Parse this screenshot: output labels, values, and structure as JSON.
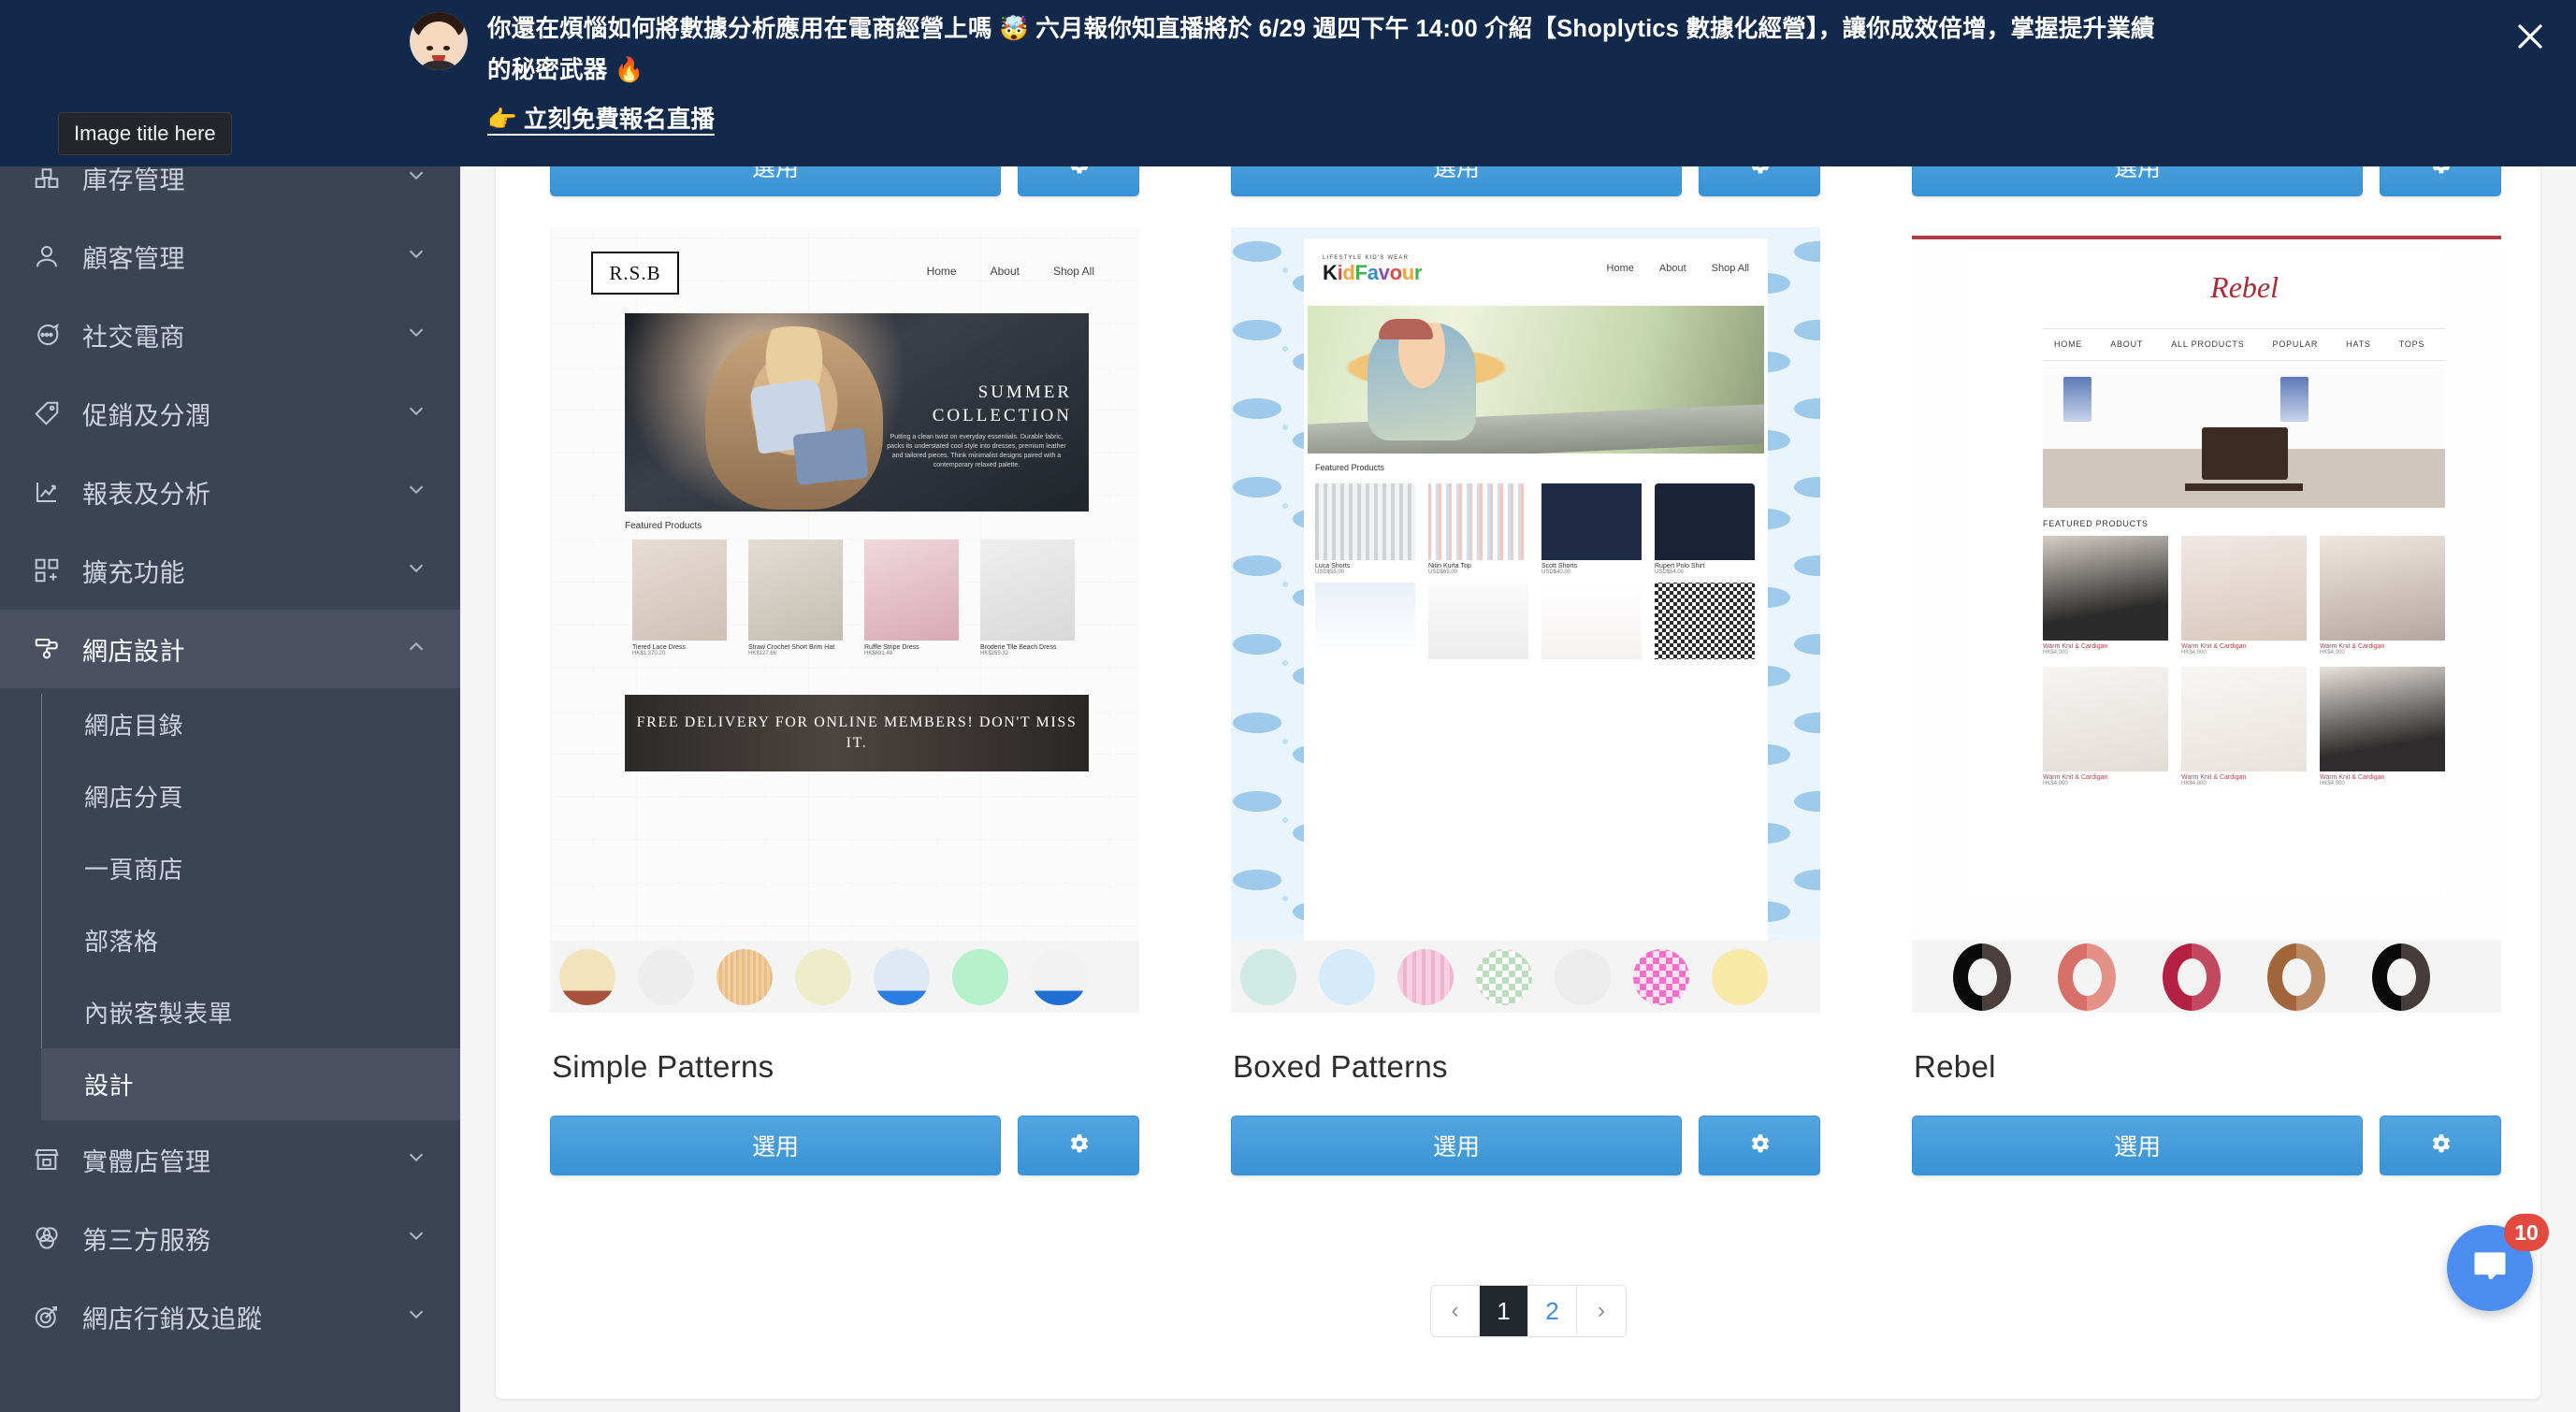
{
  "announcement": {
    "avatar_icon": "user-avatar",
    "message": "你還在煩惱如何將數據分析應用在電商經營上嗎 🤯 六月報你知直播將於 6/29 週四下午 14:00 介紹【Shoplytics 數據化經營】，讓你成效倍增，掌握提升業績的秘密武器 🔥",
    "cta_label": "👉 立刻免費報名直播",
    "close_icon": "close-icon",
    "bg_color": "#13294b"
  },
  "tooltip": {
    "text": "Image title here"
  },
  "sidebar": {
    "bg_color": "#3c4354",
    "items": [
      {
        "label": "庫存管理",
        "icon": "inventory-icon",
        "chevron": "chevron-down-icon",
        "expanded": false
      },
      {
        "label": "顧客管理",
        "icon": "user-icon",
        "chevron": "chevron-down-icon",
        "expanded": false
      },
      {
        "label": "社交電商",
        "icon": "chat-bubble-icon",
        "chevron": "chevron-down-icon",
        "expanded": false
      },
      {
        "label": "促銷及分潤",
        "icon": "tag-icon",
        "chevron": "chevron-down-icon",
        "expanded": false
      },
      {
        "label": "報表及分析",
        "icon": "chart-icon",
        "chevron": "chevron-down-icon",
        "expanded": false
      },
      {
        "label": "擴充功能",
        "icon": "grid-plus-icon",
        "chevron": "chevron-down-icon",
        "expanded": false
      },
      {
        "label": "網店設計",
        "icon": "paint-roller-icon",
        "chevron": "chevron-up-icon",
        "expanded": true
      },
      {
        "label": "實體店管理",
        "icon": "storefront-icon",
        "chevron": "chevron-down-icon",
        "expanded": false
      },
      {
        "label": "第三方服務",
        "icon": "venn-icon",
        "chevron": "chevron-down-icon",
        "expanded": false
      },
      {
        "label": "網店行銷及追蹤",
        "icon": "target-icon",
        "chevron": "chevron-down-icon",
        "expanded": false
      }
    ],
    "subitems": [
      {
        "label": "網店目錄",
        "active": false
      },
      {
        "label": "網店分頁",
        "active": false
      },
      {
        "label": "一頁商店",
        "active": false
      },
      {
        "label": "部落格",
        "active": false
      },
      {
        "label": "內嵌客製表單",
        "active": false
      },
      {
        "label": "設計",
        "active": true
      }
    ]
  },
  "main": {
    "accent_color": "#3a93d5",
    "themes": [
      {
        "name": "Simple Patterns",
        "apply_label": "選用",
        "settings_icon": "gear-icon",
        "preview": {
          "logo": "R.S.B",
          "nav": [
            "Home",
            "About",
            "Shop All"
          ],
          "hero_title": "SUMMER COLLECTION",
          "hero_body": "Putting a clean twist on everyday essentials. Durable fabric, packs its understated cool style into dresses, premium leather and tailored pieces. Think minimalist designs paired with a contemporary relaxed palette.",
          "featured_label": "Featured Products",
          "products": [
            {
              "title": "Tiered Lace Dress",
              "price": "HK$1,370.20"
            },
            {
              "title": "Straw Crochet Short Brim Hat",
              "price": "HK$127.66"
            },
            {
              "title": "Ruffle Stripe Dress",
              "price": "HK$691.48"
            },
            {
              "title": "Broderie Tile Beach Dress",
              "price": "HK$255.32"
            }
          ],
          "banner_text": "FREE DELIVERY FOR ONLINE MEMBERS! DON'T MISS IT."
        },
        "swatches": [
          "#efdfbe",
          "#eceded",
          "#f3d7a6",
          "#eee9c6",
          "#dde8f4",
          "#b9f0ce",
          "#f2f2f2"
        ]
      },
      {
        "name": "Boxed Patterns",
        "apply_label": "選用",
        "settings_icon": "gear-icon",
        "preview": {
          "logo_tagline": "LIFESTYLE KID'S WEAR",
          "logo": "KidFavour",
          "nav": [
            "Home",
            "About",
            "Shop All"
          ],
          "featured_label": "Featured Products",
          "products": [
            {
              "title": "Luca Shorts",
              "price": "USD$55.00"
            },
            {
              "title": "Nitin Kurta Top",
              "price": "USD$65.00"
            },
            {
              "title": "Scott Shorts",
              "price": "USD$40.00"
            },
            {
              "title": "Rupert Polo Shirt",
              "price": "USD$54.00"
            }
          ]
        },
        "swatches": [
          "#cfeae2",
          "#cfe6f7",
          "#f6cfe0",
          "#cce8cf",
          "#ececec",
          "#f8c8ea",
          "#f8e9a8"
        ]
      },
      {
        "name": "Rebel",
        "apply_label": "選用",
        "settings_icon": "gear-icon",
        "preview": {
          "logo": "Rebel",
          "nav": [
            "HOME",
            "ABOUT",
            "ALL PRODUCTS",
            "POPULAR",
            "HATS",
            "TOPS"
          ],
          "featured_label": "FEATURED PRODUCTS",
          "products": [
            {
              "title": "Warm Knit & Cardigan",
              "price": "HK$4,000"
            },
            {
              "title": "Warm Knit & Cardigan",
              "price": "HK$4,000"
            },
            {
              "title": "Warm Knit & Cardigan",
              "price": "HK$4,000"
            },
            {
              "title": "Warm Knit & Cardigan",
              "price": "HK$4,000"
            },
            {
              "title": "Warm Knit & Cardigan",
              "price": "HK$4,000"
            },
            {
              "title": "Warm Knit & Cardigan",
              "price": "HK$4,000"
            }
          ]
        },
        "swatches": [
          "#141414",
          "#d8756e",
          "#b92c45",
          "#a9673c",
          "#121212"
        ]
      }
    ],
    "pagination": {
      "prev_label": "‹",
      "next_label": "›",
      "pages": [
        "1",
        "2"
      ],
      "current": "1"
    }
  },
  "intercom": {
    "icon": "chat-bubble-icon",
    "badge_count": "10",
    "bg_color": "#4b8ef0",
    "badge_color": "#e24a3f"
  }
}
